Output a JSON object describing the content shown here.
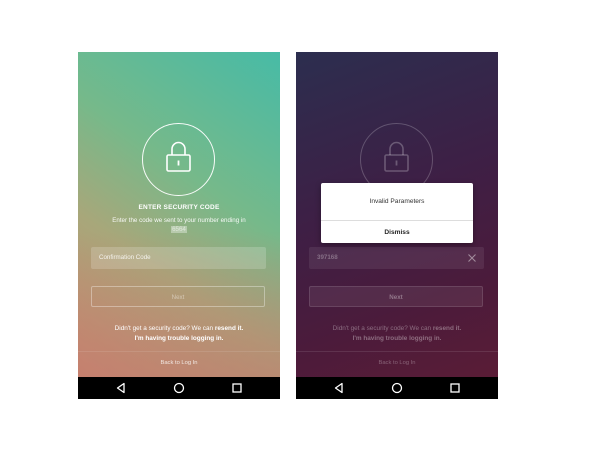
{
  "left_screen": {
    "title": "ENTER SECURITY CODE",
    "subtitle": "Enter the code we sent to your number ending in",
    "masked_digits": "6564",
    "code_placeholder": "Confirmation Code",
    "next_label": "Next",
    "help_line1": "Didn't get a security code? We can",
    "resend_label": "resend it.",
    "trouble_label": "I'm having trouble logging in.",
    "back_label": "Back to Log In"
  },
  "right_screen": {
    "code_value": "397168",
    "next_label": "Next",
    "help_line1": "Didn't get a security code? We can",
    "resend_label": "resend it.",
    "trouble_label": "I'm having trouble logging in.",
    "back_label": "Back to Log In",
    "dialog": {
      "message": "Invalid Parameters",
      "dismiss_label": "Dismiss"
    }
  },
  "icons": {
    "lock": "lock-icon",
    "clear": "close-icon",
    "nav_back": "back-triangle-icon",
    "nav_home": "home-circle-icon",
    "nav_recent": "recent-apps-square-icon"
  },
  "colors": {
    "left_gradient_top": "#47bba6",
    "left_gradient_bottom": "#c8896f",
    "right_gradient_top": "#2c2e4f",
    "right_gradient_bottom": "#5a1c36",
    "navbar": "#000000",
    "dialog_bg": "#ffffff"
  }
}
